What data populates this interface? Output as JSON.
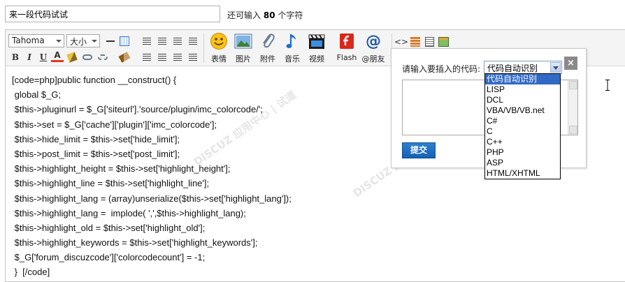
{
  "title_input": {
    "value": "来一段代码试试"
  },
  "char_limit": {
    "prefix": "还可输入",
    "count": "80",
    "suffix": "个字符"
  },
  "toolbar": {
    "font_family": "Tahoma",
    "font_size": "大小",
    "buttons": {
      "bold": "B",
      "italic": "I",
      "underline": "U",
      "color": "A"
    },
    "media": [
      {
        "label": "表情",
        "icon": "smiley-icon"
      },
      {
        "label": "图片",
        "icon": "image-icon"
      },
      {
        "label": "附件",
        "icon": "paperclip-icon"
      },
      {
        "label": "音乐",
        "icon": "music-note-icon"
      },
      {
        "label": "视频",
        "icon": "video-clapper-icon"
      },
      {
        "label": "Flash",
        "icon": "flash-icon"
      },
      {
        "label": "@朋友",
        "icon": "at-sign-icon"
      }
    ],
    "extra_icons": [
      "code-icon",
      "wall-icon",
      "quote-icon",
      "table-icon"
    ]
  },
  "content_lines": [
    "[code=php]public function __construct() {",
    " global $_G;",
    " $this->pluginurl = $_G['siteurl'].'source/plugin/imc_colorcode/';",
    " $this->set = $_G['cache']['plugin']['imc_colorcode'];",
    " $this->hide_limit = $this->set['hide_limit'];",
    " $this->post_limit = $this->set['post_limit'];",
    " $this->highlight_height = $this->set['highlight_height'];",
    " $this->highlight_line = $this->set['highlight_line'];",
    " $this->highlight_lang = (array)unserialize($this->set['highlight_lang']);",
    " $this->highlight_lang =  implode( ',',$this->highlight_lang);",
    " $this->highlight_old = $this->set['highlight_old'];",
    " $this->highlight_keywords = $this->set['highlight_keywords'];",
    " $_G['forum_discuzcode']['colorcodecount'] = -1;",
    " }  [/code]"
  ],
  "popup": {
    "label": "请输入要插入的代码:",
    "selected_lang": "代码自动识别",
    "close_label": "×",
    "submit_label": "提交",
    "lang_options": [
      "代码自动识别",
      "LISP",
      "DCL",
      "VBA/VB/VB.net",
      "C#",
      "C",
      "C++",
      "PHP",
      "ASP",
      "HTML/XHTML"
    ]
  },
  "colors": {
    "accent": "#316ac5",
    "submit": "#1561b2"
  }
}
